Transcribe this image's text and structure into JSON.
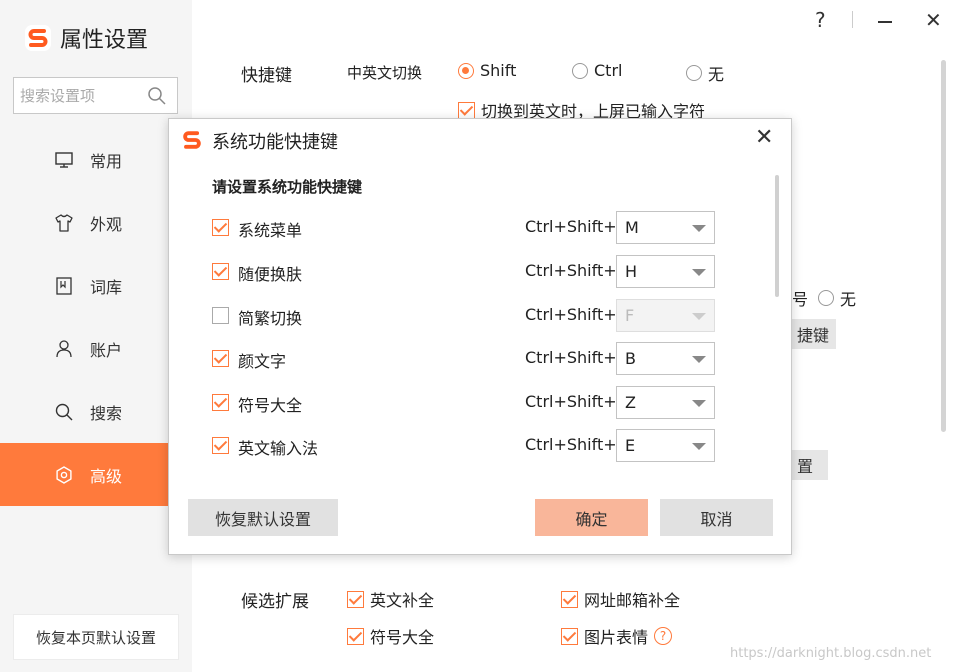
{
  "app": {
    "title": "属性设置"
  },
  "window_controls": {
    "help": "?",
    "close": "✕"
  },
  "search": {
    "placeholder": "搜索设置项"
  },
  "nav": [
    {
      "label": "常用",
      "icon": "monitor-icon"
    },
    {
      "label": "外观",
      "icon": "shirt-icon"
    },
    {
      "label": "词库",
      "icon": "book-icon"
    },
    {
      "label": "账户",
      "icon": "user-icon"
    },
    {
      "label": "搜索",
      "icon": "search-icon"
    },
    {
      "label": "高级",
      "icon": "gear-icon",
      "active": true
    }
  ],
  "restore_page_label": "恢复本页默认设置",
  "main": {
    "shortcut_label": "快捷键",
    "cn_en_switch_label": "中英文切换",
    "switch_options": [
      {
        "label": "Shift",
        "selected": true
      },
      {
        "label": "Ctrl",
        "selected": false
      },
      {
        "label": "无",
        "selected": false
      }
    ],
    "commit_on_switch": {
      "label": "切换到英文时，上屏已输入字符",
      "checked": true
    },
    "partial_radio_label": "号",
    "partial_none_label": "无",
    "partial_button_1": "捷键",
    "partial_button_2": "置",
    "candidate_ext_label": "候选扩展",
    "candidate_options": [
      {
        "label": "英文补全",
        "checked": true
      },
      {
        "label": "网址邮箱补全",
        "checked": true
      },
      {
        "label": "符号大全",
        "checked": true
      },
      {
        "label": "图片表情",
        "checked": true
      }
    ],
    "help_q": "?"
  },
  "dialog": {
    "title": "系统功能快捷键",
    "close": "✕",
    "subtitle": "请设置系统功能快捷键",
    "rows": [
      {
        "name": "系统菜单",
        "checked": true,
        "modifier": "Ctrl+Shift+",
        "key": "M",
        "disabled": false
      },
      {
        "name": "随便换肤",
        "checked": true,
        "modifier": "Ctrl+Shift+",
        "key": "H",
        "disabled": false
      },
      {
        "name": "简繁切换",
        "checked": false,
        "modifier": "Ctrl+Shift+",
        "key": "F",
        "disabled": true
      },
      {
        "name": "颜文字",
        "checked": true,
        "modifier": "Ctrl+Shift+",
        "key": "B",
        "disabled": false
      },
      {
        "name": "符号大全",
        "checked": true,
        "modifier": "Ctrl+Shift+",
        "key": "Z",
        "disabled": false
      },
      {
        "name": "英文输入法",
        "checked": true,
        "modifier": "Ctrl+Shift+",
        "key": "E",
        "disabled": false
      }
    ],
    "restore_label": "恢复默认设置",
    "ok_label": "确定",
    "cancel_label": "取消"
  },
  "watermark": "https://darknight.blog.csdn.net",
  "colors": {
    "accent": "#ff7a3c",
    "ok_button": "#f9b69a"
  }
}
